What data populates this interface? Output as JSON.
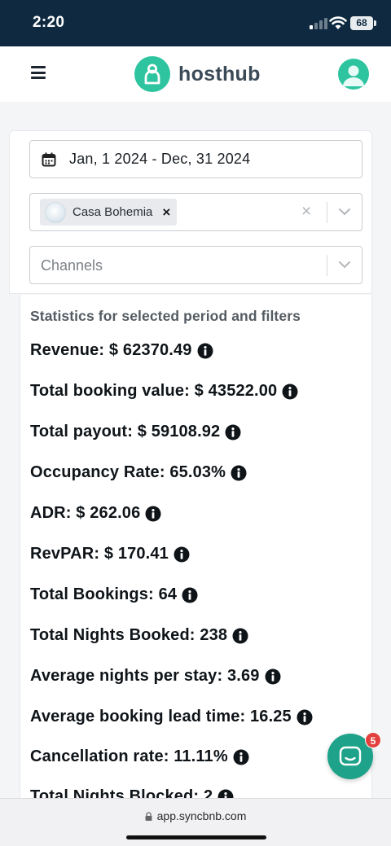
{
  "status_bar": {
    "time": "2:20",
    "battery": "68"
  },
  "header": {
    "brand": "hosthub"
  },
  "filters": {
    "date_range": "Jan, 1 2024 - Dec, 31 2024",
    "property_chip": "Casa Bohemia",
    "chip_remove": "×",
    "clear": "×",
    "channels_placeholder": "Channels"
  },
  "stats": {
    "heading": "Statistics for selected period and filters",
    "rows": [
      "Revenue: $ 62370.49",
      "Total booking value: $ 43522.00",
      "Total payout: $ 59108.92",
      "Occupancy Rate: 65.03%",
      "ADR: $ 262.06",
      "RevPAR: $ 170.41",
      "Total Bookings: 64",
      "Total Nights Booked: 238",
      "Average nights per stay: 3.69",
      "Average booking lead time: 16.25",
      "Cancellation rate: 11.11%",
      "Total Nights Blocked: 2"
    ]
  },
  "chat": {
    "badge": "5"
  },
  "browser": {
    "url": "app.syncbnb.com"
  },
  "colors": {
    "brand": "#2ec4a0",
    "status_bar": "#0f2a40",
    "chat": "#1ea38a",
    "badge": "#e3413d"
  }
}
